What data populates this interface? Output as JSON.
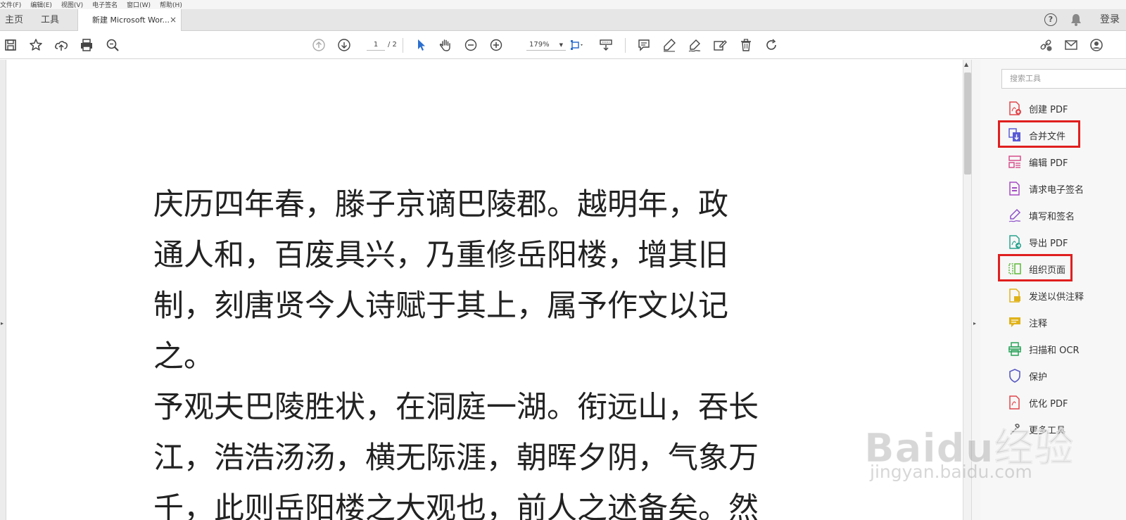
{
  "menu": [
    "文件(F)",
    "编辑(E)",
    "视图(V)",
    "电子签名",
    "窗口(W)",
    "帮助(H)"
  ],
  "tabs": {
    "home": "主页",
    "tools": "工具",
    "document": "新建 Microsoft Wor...",
    "close": "×"
  },
  "header": {
    "help": "?",
    "login": "登录"
  },
  "toolbar": {
    "page_current": "1",
    "page_total": "/ 2",
    "zoom": "179%"
  },
  "document": {
    "paragraphs": [
      [
        "庆历四年春，滕子京谪巴陵郡。越明年，政",
        "通人和，百废具兴，乃重修岳阳楼，增其旧",
        "制，刻唐贤今人诗赋于其上，属予作文以记",
        "之。"
      ],
      [
        "予观夫巴陵胜状，在洞庭一湖。衔远山，吞长",
        "江，浩浩汤汤，横无际涯，朝晖夕阴，气象万",
        "千，此则岳阳楼之大观也，前人之述备矣。然"
      ]
    ]
  },
  "right_panel": {
    "search_placeholder": "搜索工具",
    "tools": [
      {
        "label": "创建 PDF",
        "icon": "create-pdf-icon",
        "color": "#e0474c"
      },
      {
        "label": "合并文件",
        "icon": "combine-files-icon",
        "color": "#5b5bd6"
      },
      {
        "label": "编辑 PDF",
        "icon": "edit-pdf-icon",
        "color": "#d64f8c"
      },
      {
        "label": "请求电子签名",
        "icon": "request-signature-icon",
        "color": "#a54bc4"
      },
      {
        "label": "填写和签名",
        "icon": "fill-sign-icon",
        "color": "#8e4fc9"
      },
      {
        "label": "导出 PDF",
        "icon": "export-pdf-icon",
        "color": "#2aa38e"
      },
      {
        "label": "组织页面",
        "icon": "organize-pages-icon",
        "color": "#5fb83a"
      },
      {
        "label": "发送以供注释",
        "icon": "send-comments-icon",
        "color": "#e0b21a"
      },
      {
        "label": "注释",
        "icon": "comment-icon",
        "color": "#e0b21a"
      },
      {
        "label": "扫描和 OCR",
        "icon": "scan-ocr-icon",
        "color": "#2aa35a"
      },
      {
        "label": "保护",
        "icon": "protect-icon",
        "color": "#5a5ac4"
      },
      {
        "label": "优化 PDF",
        "icon": "optimize-pdf-icon",
        "color": "#e0474c"
      },
      {
        "label": "更多工具",
        "icon": "more-tools-icon",
        "color": "#666666"
      }
    ],
    "highlight_color": "#e01f1f"
  },
  "watermark": {
    "logo": "Baidu经验",
    "url": "jingyan.baidu.com"
  }
}
